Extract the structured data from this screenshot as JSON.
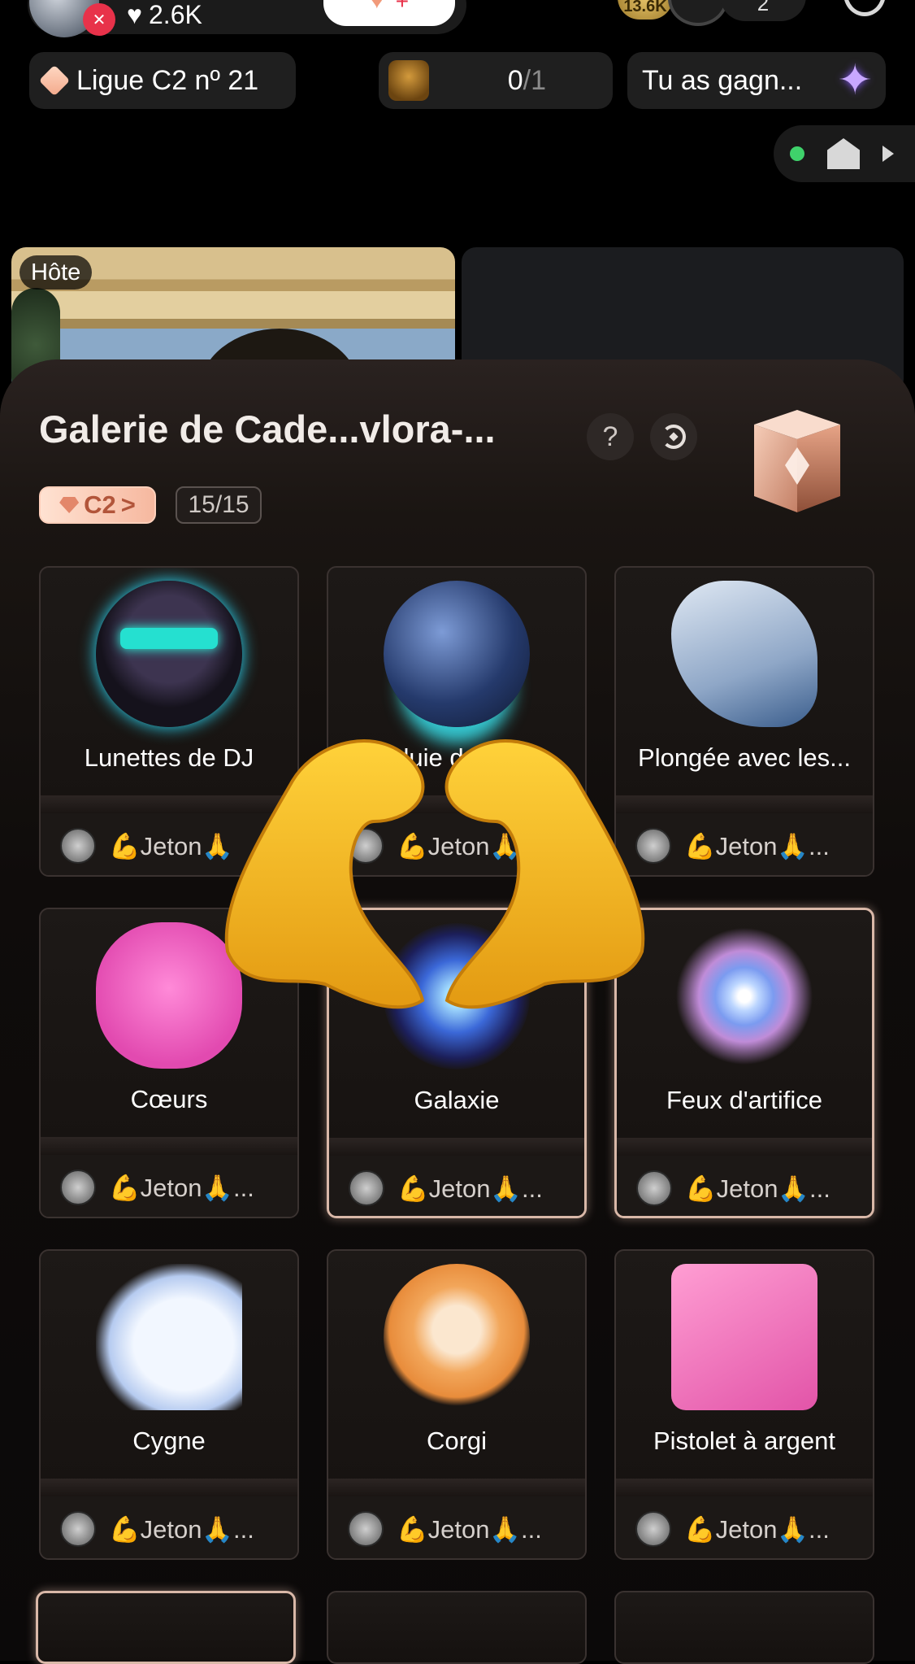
{
  "top_bar": {
    "likes": "2.6K",
    "follow_button_suffix": "+",
    "coin_count": "13.6K",
    "viewer_count": "2"
  },
  "chips": {
    "league": "Ligue C2 nº 21",
    "task_done": "0",
    "task_total": "/1",
    "reward_text": "Tu as gagn..."
  },
  "video": {
    "host_label": "Hôte"
  },
  "gallery": {
    "title": "Galerie de Cade...vlora-...",
    "help_label": "?",
    "tier_badge": "C2",
    "tier_chevron": ">",
    "progress": "15/15",
    "gifts": [
      {
        "name": "Lunettes de DJ",
        "donor": "💪Jeton🙏",
        "image": "dj-glasses",
        "highlighted": false
      },
      {
        "name": "Pluie de m...",
        "donor": "💪Jeton🙏",
        "image": "meteor-globe",
        "highlighted": false
      },
      {
        "name": "Plongée avec les...",
        "donor": "💪Jeton🙏...",
        "image": "whale",
        "highlighted": false
      },
      {
        "name": "Cœurs",
        "donor": "💪Jeton🙏...",
        "image": "hearts",
        "highlighted": false
      },
      {
        "name": "Galaxie",
        "donor": "💪Jeton🙏...",
        "image": "galaxy",
        "highlighted": true
      },
      {
        "name": "Feux d'artifice",
        "donor": "💪Jeton🙏...",
        "image": "fireworks",
        "highlighted": true
      },
      {
        "name": "Cygne",
        "donor": "💪Jeton🙏...",
        "image": "swan",
        "highlighted": false
      },
      {
        "name": "Corgi",
        "donor": "💪Jeton🙏...",
        "image": "corgi",
        "highlighted": false
      },
      {
        "name": "Pistolet à argent",
        "donor": "💪Jeton🙏...",
        "image": "money-gun",
        "highlighted": false
      }
    ]
  },
  "overlay": {
    "sticker": "heart-hands-emoji"
  },
  "colors": {
    "accent": "#f6b89f",
    "live_red": "#e8324a",
    "online_green": "#3fd26b"
  }
}
